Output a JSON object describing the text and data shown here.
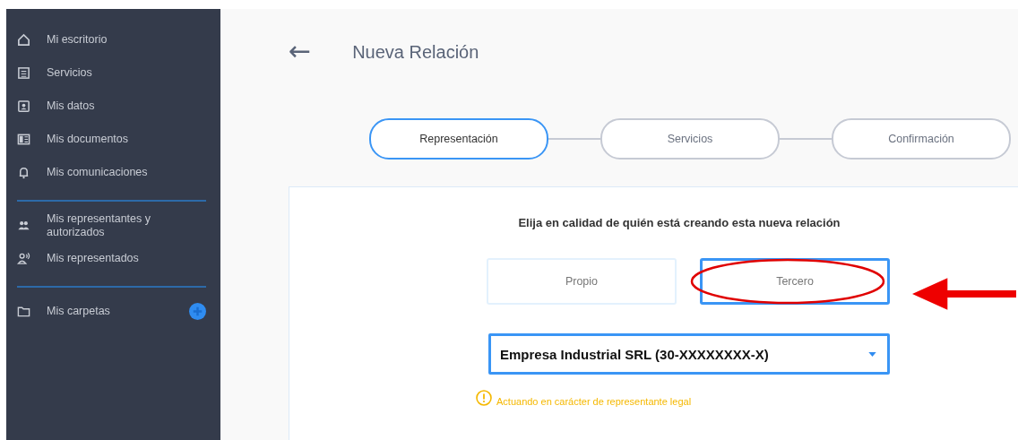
{
  "sidebar": {
    "groups": [
      {
        "items": [
          {
            "label": "Mi escritorio"
          },
          {
            "label": "Servicios"
          },
          {
            "label": "Mis datos"
          },
          {
            "label": "Mis documentos"
          },
          {
            "label": "Mis comunicaciones"
          }
        ]
      },
      {
        "items": [
          {
            "label": "Mis representantes y autorizados"
          },
          {
            "label": "Mis representados"
          }
        ]
      },
      {
        "items": [
          {
            "label": "Mis carpetas"
          }
        ]
      }
    ]
  },
  "header": {
    "back": "←",
    "title": "Nueva Relación"
  },
  "steps": [
    {
      "label": "Representación",
      "selected": true
    },
    {
      "label": "Servicios",
      "selected": false
    },
    {
      "label": "Confirmación",
      "selected": false
    }
  ],
  "form": {
    "question": "Elija en calidad de quién está creando esta nueva relación",
    "options": [
      {
        "label": "Propio",
        "selected": false
      },
      {
        "label": "Tercero",
        "selected": true
      }
    ],
    "select": {
      "value": "Empresa Industrial SRL (30-XXXXXXXX-X)"
    },
    "warning": "Actuando en carácter de representante legal"
  }
}
